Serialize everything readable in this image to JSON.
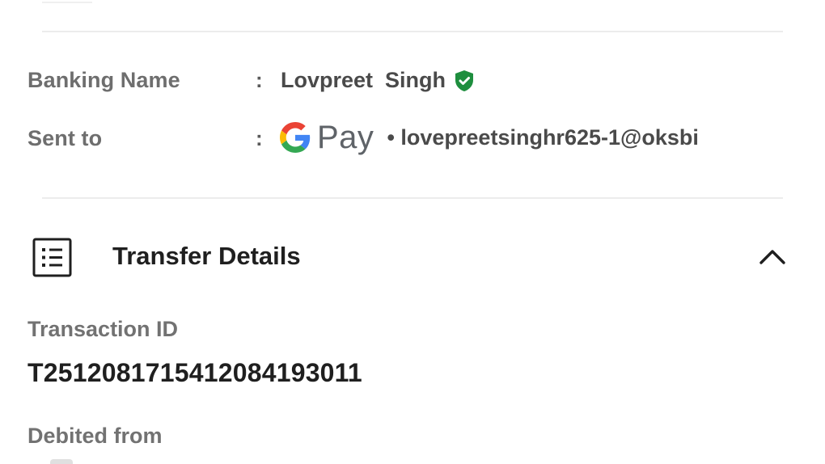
{
  "recipient": {
    "banking_name_label": "Banking Name",
    "banking_name_value": "Lovpreet  Singh",
    "sent_to_label": "Sent to",
    "sent_to_app": "Pay",
    "sent_to_upi": "• lovepreetsinghr625-1@oksbi",
    "separator": ":",
    "verified_color": "#1e8e3e"
  },
  "transfer_details": {
    "title": "Transfer Details",
    "expanded": true,
    "transaction_id_label": "Transaction ID",
    "transaction_id_value": "T2512081715412084193011",
    "debited_from_label": "Debited from"
  },
  "icons": {
    "verified": "verified-shield-icon",
    "google_g": "google-g-icon",
    "doc": "receipt-list-icon",
    "chevron": "chevron-up-icon"
  }
}
